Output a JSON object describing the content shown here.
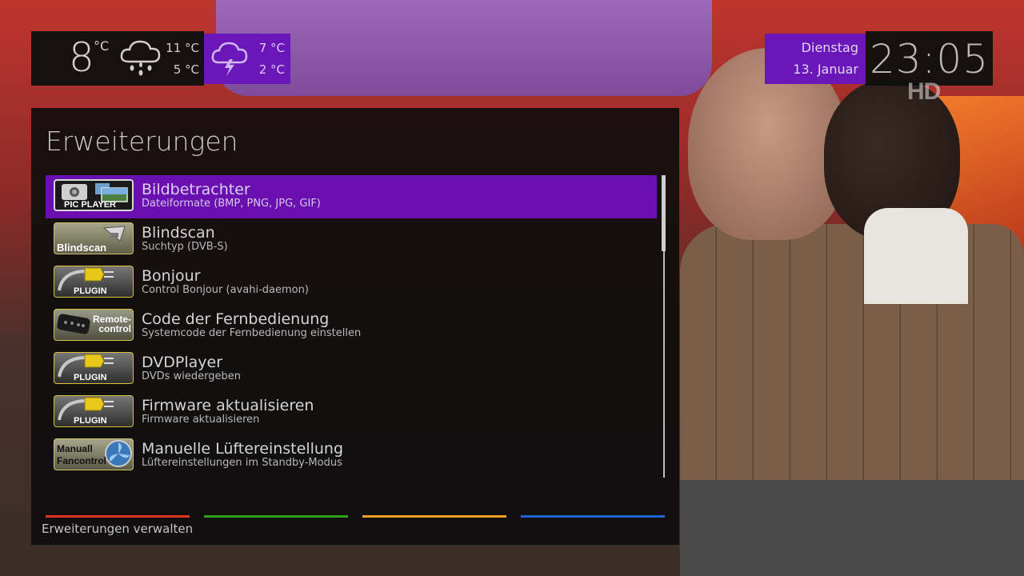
{
  "weather": {
    "current_temp": "8",
    "current_unit": "°C",
    "today_high": "11 °C",
    "today_low": "5 °C",
    "today_icon": "cloud-rain-icon",
    "tomorrow_high": "7 °C",
    "tomorrow_low": "2 °C",
    "tomorrow_icon": "cloud-thunder-icon"
  },
  "datetime": {
    "weekday": "Dienstag",
    "date": "13. Januar",
    "time": "23:05"
  },
  "channel_badge": "HD",
  "menu": {
    "title": "Erweiterungen",
    "items": [
      {
        "title": "Bildbetrachter",
        "subtitle": "Dateiformate (BMP, PNG, JPG, GIF)",
        "icon": "pic-player-icon",
        "icon_label": "PIC PLAYER",
        "selected": true
      },
      {
        "title": "Blindscan",
        "subtitle": "Suchtyp (DVB-S)",
        "icon": "blindscan-icon",
        "icon_label": "Blindscan",
        "selected": false
      },
      {
        "title": "Bonjour",
        "subtitle": "Control Bonjour (avahi-daemon)",
        "icon": "plugin-icon",
        "icon_label": "PLUGIN",
        "selected": false
      },
      {
        "title": "Code der Fernbedienung",
        "subtitle": "Systemcode der Fernbedienung einstellen",
        "icon": "remote-control-icon",
        "icon_label": "Remote-\ncontrol",
        "selected": false
      },
      {
        "title": "DVDPlayer",
        "subtitle": "DVDs wiedergeben",
        "icon": "plugin-icon",
        "icon_label": "PLUGIN",
        "selected": false
      },
      {
        "title": "Firmware aktualisieren",
        "subtitle": "Firmware aktualisieren",
        "icon": "plugin-icon",
        "icon_label": "PLUGIN",
        "selected": false
      },
      {
        "title": "Manuelle Lüftereinstellung",
        "subtitle": "Lüftereinstellungen im Standby-Modus",
        "icon": "fancontrol-icon",
        "icon_label": "Manuall\nFancontrol",
        "selected": false
      }
    ]
  },
  "color_buttons": {
    "red": "#e0321e",
    "green": "#2fa01e",
    "yellow": "#f0a028",
    "blue": "#1e64d2"
  },
  "footer": {
    "red_label": "Erweiterungen verwalten"
  },
  "colors": {
    "accent_purple": "#6a0fb0",
    "panel_bg": "#0c0c0c"
  }
}
